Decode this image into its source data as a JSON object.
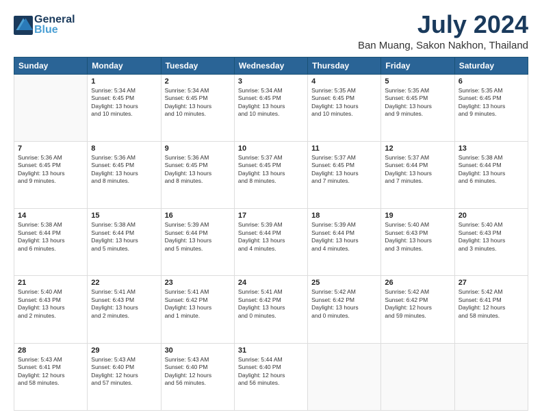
{
  "logo": {
    "line1": "General",
    "line2": "Blue"
  },
  "title": "July 2024",
  "subtitle": "Ban Muang, Sakon Nakhon, Thailand",
  "days_of_week": [
    "Sunday",
    "Monday",
    "Tuesday",
    "Wednesday",
    "Thursday",
    "Friday",
    "Saturday"
  ],
  "weeks": [
    [
      {
        "day": "",
        "info": ""
      },
      {
        "day": "1",
        "info": "Sunrise: 5:34 AM\nSunset: 6:45 PM\nDaylight: 13 hours\nand 10 minutes."
      },
      {
        "day": "2",
        "info": "Sunrise: 5:34 AM\nSunset: 6:45 PM\nDaylight: 13 hours\nand 10 minutes."
      },
      {
        "day": "3",
        "info": "Sunrise: 5:34 AM\nSunset: 6:45 PM\nDaylight: 13 hours\nand 10 minutes."
      },
      {
        "day": "4",
        "info": "Sunrise: 5:35 AM\nSunset: 6:45 PM\nDaylight: 13 hours\nand 10 minutes."
      },
      {
        "day": "5",
        "info": "Sunrise: 5:35 AM\nSunset: 6:45 PM\nDaylight: 13 hours\nand 9 minutes."
      },
      {
        "day": "6",
        "info": "Sunrise: 5:35 AM\nSunset: 6:45 PM\nDaylight: 13 hours\nand 9 minutes."
      }
    ],
    [
      {
        "day": "7",
        "info": "Sunrise: 5:36 AM\nSunset: 6:45 PM\nDaylight: 13 hours\nand 9 minutes."
      },
      {
        "day": "8",
        "info": "Sunrise: 5:36 AM\nSunset: 6:45 PM\nDaylight: 13 hours\nand 8 minutes."
      },
      {
        "day": "9",
        "info": "Sunrise: 5:36 AM\nSunset: 6:45 PM\nDaylight: 13 hours\nand 8 minutes."
      },
      {
        "day": "10",
        "info": "Sunrise: 5:37 AM\nSunset: 6:45 PM\nDaylight: 13 hours\nand 8 minutes."
      },
      {
        "day": "11",
        "info": "Sunrise: 5:37 AM\nSunset: 6:45 PM\nDaylight: 13 hours\nand 7 minutes."
      },
      {
        "day": "12",
        "info": "Sunrise: 5:37 AM\nSunset: 6:44 PM\nDaylight: 13 hours\nand 7 minutes."
      },
      {
        "day": "13",
        "info": "Sunrise: 5:38 AM\nSunset: 6:44 PM\nDaylight: 13 hours\nand 6 minutes."
      }
    ],
    [
      {
        "day": "14",
        "info": "Sunrise: 5:38 AM\nSunset: 6:44 PM\nDaylight: 13 hours\nand 6 minutes."
      },
      {
        "day": "15",
        "info": "Sunrise: 5:38 AM\nSunset: 6:44 PM\nDaylight: 13 hours\nand 5 minutes."
      },
      {
        "day": "16",
        "info": "Sunrise: 5:39 AM\nSunset: 6:44 PM\nDaylight: 13 hours\nand 5 minutes."
      },
      {
        "day": "17",
        "info": "Sunrise: 5:39 AM\nSunset: 6:44 PM\nDaylight: 13 hours\nand 4 minutes."
      },
      {
        "day": "18",
        "info": "Sunrise: 5:39 AM\nSunset: 6:44 PM\nDaylight: 13 hours\nand 4 minutes."
      },
      {
        "day": "19",
        "info": "Sunrise: 5:40 AM\nSunset: 6:43 PM\nDaylight: 13 hours\nand 3 minutes."
      },
      {
        "day": "20",
        "info": "Sunrise: 5:40 AM\nSunset: 6:43 PM\nDaylight: 13 hours\nand 3 minutes."
      }
    ],
    [
      {
        "day": "21",
        "info": "Sunrise: 5:40 AM\nSunset: 6:43 PM\nDaylight: 13 hours\nand 2 minutes."
      },
      {
        "day": "22",
        "info": "Sunrise: 5:41 AM\nSunset: 6:43 PM\nDaylight: 13 hours\nand 2 minutes."
      },
      {
        "day": "23",
        "info": "Sunrise: 5:41 AM\nSunset: 6:42 PM\nDaylight: 13 hours\nand 1 minute."
      },
      {
        "day": "24",
        "info": "Sunrise: 5:41 AM\nSunset: 6:42 PM\nDaylight: 13 hours\nand 0 minutes."
      },
      {
        "day": "25",
        "info": "Sunrise: 5:42 AM\nSunset: 6:42 PM\nDaylight: 13 hours\nand 0 minutes."
      },
      {
        "day": "26",
        "info": "Sunrise: 5:42 AM\nSunset: 6:42 PM\nDaylight: 12 hours\nand 59 minutes."
      },
      {
        "day": "27",
        "info": "Sunrise: 5:42 AM\nSunset: 6:41 PM\nDaylight: 12 hours\nand 58 minutes."
      }
    ],
    [
      {
        "day": "28",
        "info": "Sunrise: 5:43 AM\nSunset: 6:41 PM\nDaylight: 12 hours\nand 58 minutes."
      },
      {
        "day": "29",
        "info": "Sunrise: 5:43 AM\nSunset: 6:40 PM\nDaylight: 12 hours\nand 57 minutes."
      },
      {
        "day": "30",
        "info": "Sunrise: 5:43 AM\nSunset: 6:40 PM\nDaylight: 12 hours\nand 56 minutes."
      },
      {
        "day": "31",
        "info": "Sunrise: 5:44 AM\nSunset: 6:40 PM\nDaylight: 12 hours\nand 56 minutes."
      },
      {
        "day": "",
        "info": ""
      },
      {
        "day": "",
        "info": ""
      },
      {
        "day": "",
        "info": ""
      }
    ]
  ]
}
